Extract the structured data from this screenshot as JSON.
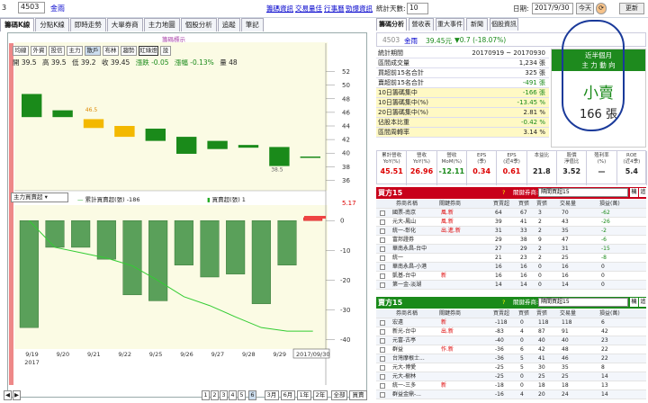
{
  "topbar": {
    "left_num": "3",
    "stock_code": "4503",
    "stock_name": "金雨",
    "links": [
      "籌碼資訊",
      "交易量佳",
      "行事曆",
      "勁爆資訊"
    ],
    "days_label": "統計天數:",
    "days_value": "10",
    "date_label": "日期:",
    "date_value": "2017/9/30",
    "today_btn": "今天",
    "refresh_btn": "更新"
  },
  "left_tabs": [
    "籌碼K線",
    "分點K線",
    "即時走勢",
    "大單券商",
    "主力地圖",
    "個股分析",
    "追蹤",
    "筆記"
  ],
  "chart_buttons": [
    "均線",
    "外資",
    "投信",
    "主力",
    "散戶",
    "布林",
    "趨勢",
    "紅綠燈",
    "設"
  ],
  "chart_dropdown": "籌碼標示",
  "ohlc": {
    "o": "開 39.5",
    "h": "高 39.5",
    "l": "低 39.2",
    "c": "收 39.45",
    "chg": "漲跌 -0.05",
    "pct": "漲幅 -0.13%",
    "vol": "量 48"
  },
  "indicator": {
    "select": "主力買賣超",
    "legend1": "累計買賣超(張) -186",
    "legend2": "買賣超(張) 1",
    "right_value": "5.17"
  },
  "chart_data": [
    {
      "type": "candlestick",
      "x": [
        "9/19",
        "9/20",
        "9/21",
        "9/22",
        "9/25",
        "9/26",
        "9/27",
        "9/28",
        "9/29",
        "9/30"
      ],
      "open": [
        48.7,
        46.3,
        45.0,
        44.0,
        43.6,
        42.4,
        41.8,
        41.2,
        40.9,
        39.5
      ],
      "close": [
        45.3,
        45.3,
        43.7,
        42.4,
        41.8,
        39.9,
        40.6,
        40.8,
        38.1,
        39.45
      ],
      "annotations": [
        "46.5",
        "38.5"
      ],
      "yticks": [
        52,
        50,
        48,
        46,
        44,
        42,
        40,
        38,
        36
      ],
      "ylim": [
        35,
        53
      ]
    },
    {
      "type": "bar",
      "series": [
        {
          "values": [
            -36,
            -9,
            -9,
            -13,
            -25,
            -27,
            -15,
            -19,
            -18,
            -28,
            -15,
            1
          ]
        }
      ],
      "cumulative": [
        0,
        -45,
        -54,
        -63,
        -76,
        -101,
        -128,
        -143,
        -162,
        -180,
        -186,
        -186
      ],
      "yticks": [
        0,
        -10,
        -20,
        -30,
        -40
      ],
      "ylim": [
        -42,
        4
      ]
    }
  ],
  "x_labels": [
    "9/19",
    "9/20",
    "9/21",
    "9/22",
    "9/25",
    "9/26",
    "9/27",
    "9/28",
    "9/29"
  ],
  "x_year": "2017",
  "x_end_label": "2017/09/30",
  "bottom_buttons": [
    "1",
    "2",
    "3",
    "4",
    "5",
    "6",
    "3月",
    "6月",
    "1年",
    "2年",
    "全部",
    "買賣"
  ],
  "right_tabs": [
    "籌碼分析",
    "營收表",
    "重大事件",
    "新聞",
    "個股資訊"
  ],
  "stock_header": {
    "code": "4503",
    "name": "金雨",
    "price": "39.45元",
    "change": "▼0.7 (-18.07%)"
  },
  "stats": [
    {
      "k": "統計期間",
      "v": "20170919 ~ 20170930"
    },
    {
      "k": "區間成交量",
      "v": "1,234 張"
    },
    {
      "k": "買超前15名合計",
      "v": "325 張"
    },
    {
      "k": "賣超前15名合計",
      "v": "-491 張"
    },
    {
      "k": "10日籌碼集中",
      "v": "-166 張"
    },
    {
      "k": "10日籌碼集中(%)",
      "v": "-13.45 %"
    },
    {
      "k": "20日籌碼集中(%)",
      "v": "2.81 %"
    },
    {
      "k": "佔股本比重",
      "v": "-0.42 %"
    },
    {
      "k": "區間周轉率",
      "v": "3.14 %"
    }
  ],
  "major": {
    "head1": "近半個月",
    "head2": "主 力 動 向",
    "side": "小賣",
    "qty": "166 張"
  },
  "metrics": [
    {
      "h": "累計營收\nYoY(%)",
      "v": "45.51",
      "c": "red"
    },
    {
      "h": "營收\nYoY(%)",
      "v": "26.96",
      "c": "red"
    },
    {
      "h": "營收\nMoM(%)",
      "v": "-12.11",
      "c": "green"
    },
    {
      "h": "EPS\n(季)",
      "v": "0.34",
      "c": "red"
    },
    {
      "h": "EPS\n(近4季)",
      "v": "0.61",
      "c": "red"
    },
    {
      "h": "本益比",
      "v": "21.8",
      "c": "black"
    },
    {
      "h": "股價\n淨值比",
      "v": "3.52",
      "c": "black"
    },
    {
      "h": "殖利率\n(%)",
      "v": "—",
      "c": "black"
    },
    {
      "h": "ROE\n(近4季)",
      "v": "5.4",
      "c": "black"
    }
  ],
  "buy_section": {
    "title": "買方15",
    "q": "?",
    "label": "關鍵券商:",
    "select": "隔間買超15",
    "btn1": "機",
    "btn2": "追"
  },
  "sell_section": {
    "title": "賣方15",
    "q": "?",
    "label": "關鍵券商:",
    "select": "隔間買超15",
    "btn1": "機",
    "btn2": "追"
  },
  "table_headers": [
    "券商名稱",
    "關鍵券商",
    "買賣超",
    "買張",
    "賣張",
    "交易量",
    "損益(萬)"
  ],
  "buy_rows": [
    [
      "國票-南京",
      "風.新",
      "64",
      "67",
      "3",
      "70",
      "-62"
    ],
    [
      "元大-鳳山",
      "風.新",
      "39",
      "41",
      "2",
      "43",
      "-26"
    ],
    [
      "統一-彰化",
      "出.進.新",
      "31",
      "33",
      "2",
      "35",
      "-2"
    ],
    [
      "富邦證券",
      "",
      "29",
      "38",
      "9",
      "47",
      "-6"
    ],
    [
      "華南永昌-台中",
      "",
      "27",
      "29",
      "2",
      "31",
      "-15"
    ],
    [
      "統一",
      "",
      "21",
      "23",
      "2",
      "25",
      "-8"
    ],
    [
      "華南永昌-小港",
      "",
      "16",
      "16",
      "0",
      "16",
      "0"
    ],
    [
      "凱基-台中",
      "新",
      "16",
      "16",
      "0",
      "16",
      "0"
    ],
    [
      "第一金-淡湖",
      "",
      "14",
      "14",
      "0",
      "14",
      "0"
    ]
  ],
  "sell_rows": [
    [
      "宏遠",
      "新",
      "-118",
      "0",
      "118",
      "118",
      "6"
    ],
    [
      "新光-台中",
      "出.新",
      "-83",
      "4",
      "87",
      "91",
      "42"
    ],
    [
      "元富-古亭",
      "",
      "-40",
      "0",
      "40",
      "40",
      "23"
    ],
    [
      "群益",
      "作.新",
      "-36",
      "6",
      "42",
      "48",
      "22"
    ],
    [
      "台灣摩根士...",
      "",
      "-36",
      "5",
      "41",
      "46",
      "22"
    ],
    [
      "元大-博愛",
      "",
      "-25",
      "5",
      "30",
      "35",
      "8"
    ],
    [
      "元大-樹林",
      "",
      "-25",
      "0",
      "25",
      "25",
      "14"
    ],
    [
      "統一-三多",
      "新",
      "-18",
      "0",
      "18",
      "18",
      "13"
    ],
    [
      "群益金鼎-...",
      "",
      "-16",
      "4",
      "20",
      "24",
      "14"
    ]
  ]
}
